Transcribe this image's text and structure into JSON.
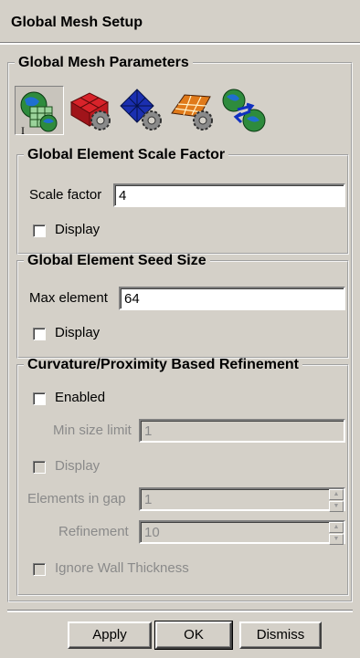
{
  "window": {
    "title": "Global Mesh Setup"
  },
  "parameters": {
    "legend": "Global Mesh Parameters",
    "icons": [
      "global-mesh-icon",
      "mesh-gear-red-icon",
      "mesh-gear-blue-icon",
      "surface-mesh-gear-icon",
      "globe-arrows-icon"
    ],
    "selected_icon": 0
  },
  "scale_factor": {
    "legend": "Global Element Scale Factor",
    "label": "Scale factor",
    "value": "4",
    "display_label": "Display",
    "display_checked": false
  },
  "seed_size": {
    "legend": "Global Element Seed Size",
    "label": "Max element",
    "value": "64",
    "display_label": "Display",
    "display_checked": false
  },
  "refinement": {
    "legend": "Curvature/Proximity Based Refinement",
    "enabled_label": "Enabled",
    "enabled_checked": false,
    "min_size_label": "Min size limit",
    "min_size_value": "1",
    "display_label": "Display",
    "elements_in_gap_label": "Elements in gap",
    "elements_in_gap_value": "1",
    "refinement_label": "Refinement",
    "refinement_value": "10",
    "ignore_wall_label": "Ignore Wall Thickness"
  },
  "buttons": {
    "apply": "Apply",
    "ok": "OK",
    "dismiss": "Dismiss"
  },
  "colors": {
    "background": "#d4d0c8",
    "disabled_text": "#8a8a8a"
  }
}
